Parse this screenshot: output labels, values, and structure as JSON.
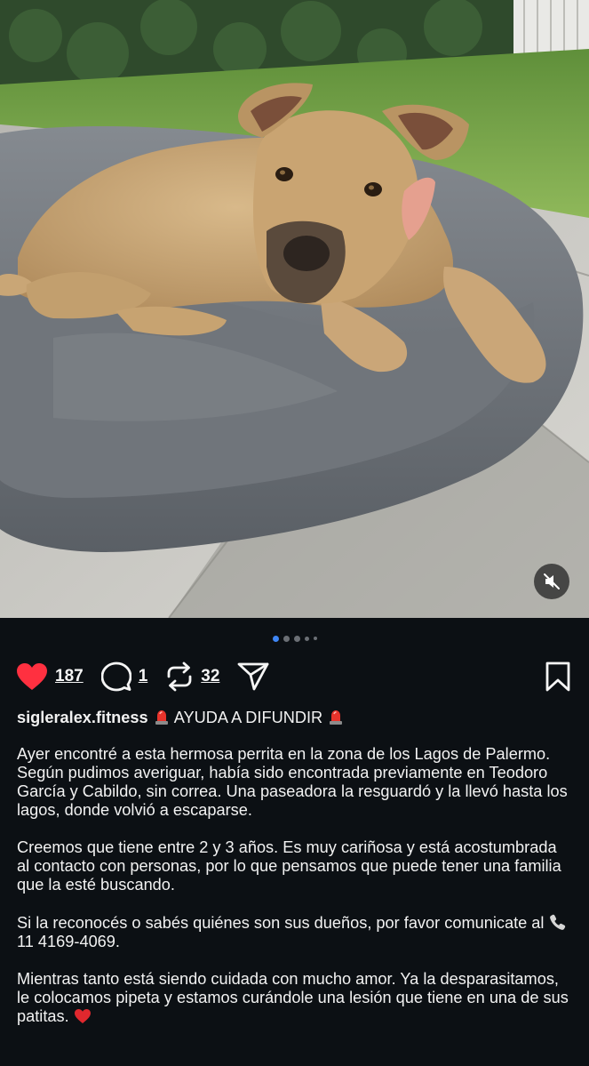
{
  "post": {
    "media": {
      "alt": "Perrita color caramelo recostada sobre un almohadón gris en un patio con césped",
      "carousel_dots": 5,
      "active_dot": 0,
      "mute_icon": "speaker-muted-icon"
    },
    "actions": {
      "like_icon": "heart-filled-icon",
      "like_color": "#ff3040",
      "likes": "187",
      "comment_icon": "comment-bubble-icon",
      "comments": "1",
      "repost_icon": "repost-icon",
      "reposts": "32",
      "share_icon": "paper-plane-icon",
      "bookmark_icon": "bookmark-icon"
    },
    "caption": {
      "username": "sigleralex.fitness",
      "headline": "AYUDA A DIFUNDIR",
      "siren_icon": "rotating-light-icon",
      "paragraphs": [
        "Ayer encontré a esta hermosa perrita en la zona de los Lagos de Palermo. Según pudimos averiguar, había sido encontrada previamente en Teodoro García y Cabildo, sin correa. Una paseadora la resguardó y la llevó hasta los lagos, donde volvió a escaparse.",
        "Creemos que tiene entre 2 y 3 años. Es muy cariñosa y está acostumbrada al contacto con personas, por lo que pensamos que puede tener una familia que la esté buscando."
      ],
      "contact_prefix": "Si la reconocés o sabés quiénes son sus dueños, por favor comunicate al",
      "phone_icon": "telephone-receiver-icon",
      "phone": "11 4169-4069.",
      "closing": "Mientras tanto está siendo cuidada con mucho amor. Ya la desparasitamos, le colocamos pipeta y estamos curándole una lesión que tiene en una de sus patitas.",
      "closing_emoji": "red-heart-icon"
    }
  }
}
